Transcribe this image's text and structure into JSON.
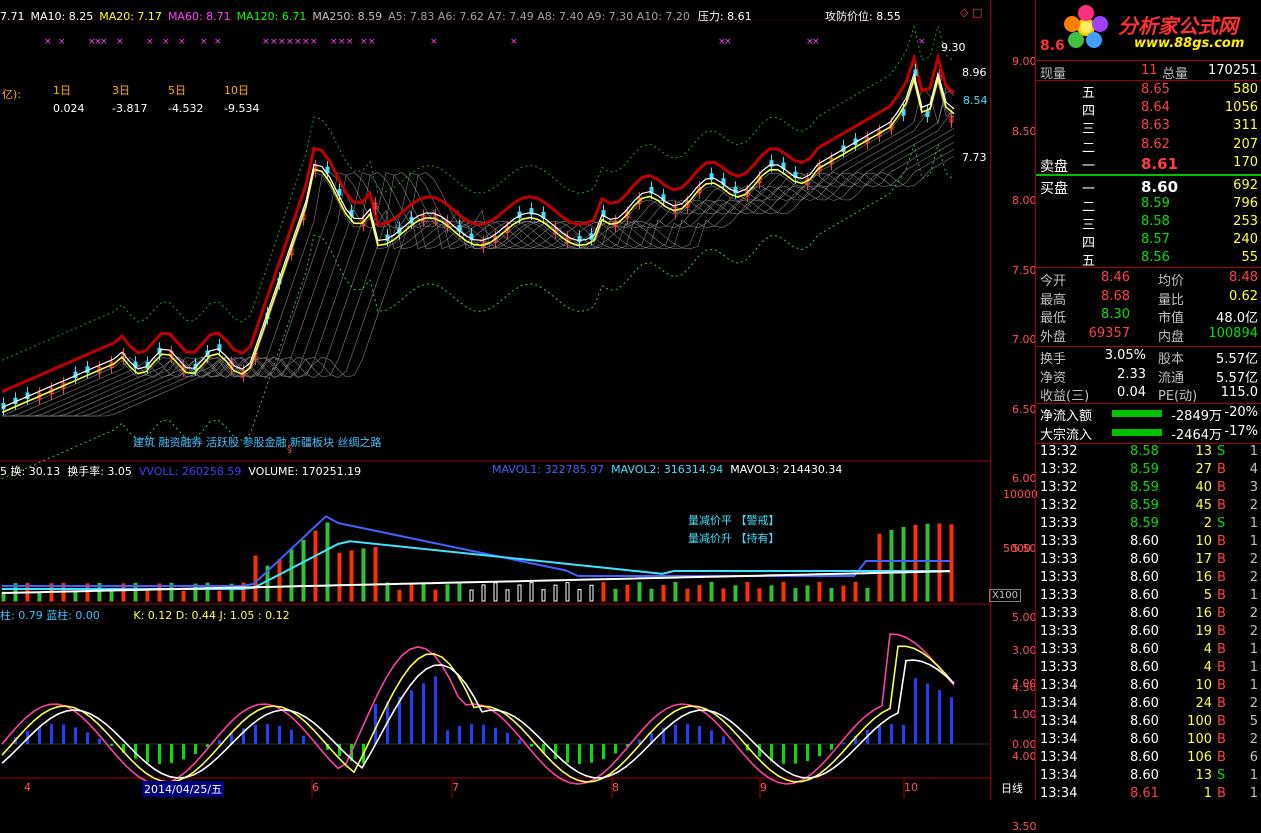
{
  "main_header": {
    "items": [
      {
        "text": "7.71",
        "color": "#ffffff"
      },
      {
        "text": "MA10: 8.25",
        "color": "#ffffff"
      },
      {
        "text": "MA20: 7.17",
        "color": "#ffff40"
      },
      {
        "text": "MA60: 8.71",
        "color": "#ff40ff"
      },
      {
        "text": "MA120: 6.71",
        "color": "#00ff00"
      },
      {
        "text": "MA250: 8.59",
        "color": "#c0c0c0"
      },
      {
        "text": "A5: 7.83 A6: 7.62 A7: 7.49 A8: 7.40 A9: 7.30 A10: 7.20",
        "color": "#a0a0a0"
      },
      {
        "text": "压力: 8.61",
        "color": "#ffffff"
      }
    ],
    "attack_defense": "攻防价位: 8.55"
  },
  "flow_table": {
    "unit_label": "亿):",
    "periods": [
      "1日",
      "3日",
      "5日",
      "10日"
    ],
    "values": [
      "0.024",
      "-3.817",
      "-4.532",
      "-9.534"
    ]
  },
  "concepts": "建筑  融资融券  活跃股  参股金融  新疆板块  丝绸之路",
  "price_annotations": {
    "high": "9.30",
    "a": "8.96",
    "b": "8.54",
    "c": "7.73",
    "low_marker": "§"
  },
  "price_axis": [
    "9.00",
    "8.50",
    "8.00",
    "7.50",
    "7.00",
    "6.50",
    "6.00",
    "5.50",
    "5.00",
    "4.50",
    "4.00",
    "3.50"
  ],
  "volume_header": {
    "a": "5 换: 30.13",
    "b": "换手率: 3.05",
    "c": "VVOLL: 260258.59",
    "d": "VOLUME: 170251.19",
    "e": "MAVOL1: 322785.97",
    "f": "MAVOL2: 316314.94",
    "g": "MAVOL3: 214430.34"
  },
  "volume_axis": [
    "10000",
    "5000"
  ],
  "volume_unit": "X100",
  "vol_notes": [
    "量减价平 【警戒】",
    "量减价升 【持有】"
  ],
  "kdj_header": {
    "a": "柱: 0.79  蓝柱: 0.00",
    "b": "K: 0.12  D: 0.44  J: 1.05   : 0.12"
  },
  "kdj_axis": [
    "3.00",
    "2.00",
    "1.00",
    "0.00"
  ],
  "date_axis": {
    "labels": [
      "4",
      "2014/04/25/五",
      "6",
      "7",
      "8",
      "9",
      "10"
    ],
    "period": "日线"
  },
  "panel": {
    "logo_title": "分析家公式网",
    "logo_url": "www.88gs.com",
    "price_big": "8.6",
    "vol_now_label": "现量",
    "vol_now": "11",
    "vol_total_label": "总量",
    "vol_total": "170251",
    "sell_label": "卖盘",
    "buy_label": "买盘",
    "asks": [
      {
        "lvl": "五",
        "price": "8.65",
        "vol": "580"
      },
      {
        "lvl": "四",
        "price": "8.64",
        "vol": "1056"
      },
      {
        "lvl": "三",
        "price": "8.63",
        "vol": "311"
      },
      {
        "lvl": "二",
        "price": "8.62",
        "vol": "207"
      },
      {
        "lvl": "一",
        "price": "8.61",
        "vol": "170"
      }
    ],
    "bids": [
      {
        "lvl": "一",
        "price": "8.60",
        "vol": "692"
      },
      {
        "lvl": "二",
        "price": "8.59",
        "vol": "796"
      },
      {
        "lvl": "三",
        "price": "8.58",
        "vol": "253"
      },
      {
        "lvl": "四",
        "price": "8.57",
        "vol": "240"
      },
      {
        "lvl": "五",
        "price": "8.56",
        "vol": "55"
      }
    ],
    "stats": [
      {
        "l1": "今开",
        "v1": "8.46",
        "c1": "#ff4040",
        "l2": "均价",
        "v2": "8.48",
        "c2": "#ff4040"
      },
      {
        "l1": "最高",
        "v1": "8.68",
        "c1": "#ff4040",
        "l2": "量比",
        "v2": "0.62",
        "c2": "#ffff40"
      },
      {
        "l1": "最低",
        "v1": "8.30",
        "c1": "#00e000",
        "l2": "市值",
        "v2": "48.0亿",
        "c2": "#ffffff"
      },
      {
        "l1": "外盘",
        "v1": "69357",
        "c1": "#ff4040",
        "l2": "内盘",
        "v2": "100894",
        "c2": "#00e000"
      }
    ],
    "stats2": [
      {
        "l1": "换手",
        "v1": "3.05%",
        "l2": "股本",
        "v2": "5.57亿"
      },
      {
        "l1": "净资",
        "v1": "2.33",
        "l2": "流通",
        "v2": "5.57亿"
      },
      {
        "l1": "收益(三)",
        "v1": "0.04",
        "l2": "PE(动)",
        "v2": "115.0"
      }
    ],
    "flows": [
      {
        "label": "净流入额",
        "val": "-2849万",
        "pct": "-20%"
      },
      {
        "label": "大宗流入",
        "val": "-2464万",
        "pct": "-17%"
      }
    ],
    "ticks": [
      {
        "t": "13:32",
        "p": "8.58",
        "v": "13",
        "s": "S",
        "n": "1"
      },
      {
        "t": "13:32",
        "p": "8.59",
        "v": "27",
        "s": "B",
        "n": "4"
      },
      {
        "t": "13:32",
        "p": "8.59",
        "v": "40",
        "s": "B",
        "n": "3"
      },
      {
        "t": "13:32",
        "p": "8.59",
        "v": "45",
        "s": "B",
        "n": "2"
      },
      {
        "t": "13:33",
        "p": "8.59",
        "v": "2",
        "s": "S",
        "n": "1"
      },
      {
        "t": "13:33",
        "p": "8.60",
        "v": "10",
        "s": "B",
        "n": "1"
      },
      {
        "t": "13:33",
        "p": "8.60",
        "v": "17",
        "s": "B",
        "n": "2"
      },
      {
        "t": "13:33",
        "p": "8.60",
        "v": "16",
        "s": "B",
        "n": "2"
      },
      {
        "t": "13:33",
        "p": "8.60",
        "v": "5",
        "s": "B",
        "n": "1"
      },
      {
        "t": "13:33",
        "p": "8.60",
        "v": "16",
        "s": "B",
        "n": "2"
      },
      {
        "t": "13:33",
        "p": "8.60",
        "v": "19",
        "s": "B",
        "n": "2"
      },
      {
        "t": "13:33",
        "p": "8.60",
        "v": "4",
        "s": "B",
        "n": "1"
      },
      {
        "t": "13:33",
        "p": "8.60",
        "v": "4",
        "s": "B",
        "n": "1"
      },
      {
        "t": "13:34",
        "p": "8.60",
        "v": "10",
        "s": "B",
        "n": "1"
      },
      {
        "t": "13:34",
        "p": "8.60",
        "v": "24",
        "s": "B",
        "n": "2"
      },
      {
        "t": "13:34",
        "p": "8.60",
        "v": "100",
        "s": "B",
        "n": "5"
      },
      {
        "t": "13:34",
        "p": "8.60",
        "v": "100",
        "s": "B",
        "n": "2"
      },
      {
        "t": "13:34",
        "p": "8.60",
        "v": "106",
        "s": "B",
        "n": "6"
      },
      {
        "t": "13:34",
        "p": "8.60",
        "v": "13",
        "s": "S",
        "n": "1"
      },
      {
        "t": "13:34",
        "p": "8.61",
        "v": "1",
        "s": "B",
        "n": "1"
      }
    ]
  }
}
